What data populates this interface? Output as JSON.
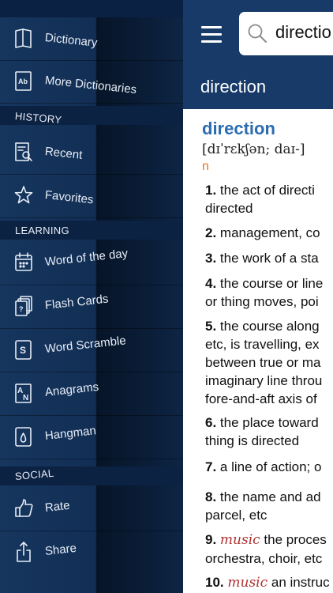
{
  "sidebar": {
    "items": {
      "dictionary": "Dictionary",
      "more_dictionaries": "More Dictionaries",
      "recent": "Recent",
      "favorites": "Favorites",
      "word_of_day": "Word of the day",
      "flash_cards": "Flash Cards",
      "word_scramble": "Word Scramble",
      "anagrams": "Anagrams",
      "hangman": "Hangman",
      "rate": "Rate",
      "share": "Share"
    },
    "sections": {
      "history": "HISTORY",
      "learning": "LEARNING",
      "social": "SOCIAL"
    },
    "icon_glyphs": {
      "more_dictionaries": "Ab",
      "word_scramble": "S",
      "anagrams_a": "A",
      "anagrams_n": "N",
      "flash_cards": "?"
    }
  },
  "header": {
    "search_value": "directio",
    "word_title": "direction"
  },
  "entry": {
    "headword": "direction",
    "pronunciation": "[dɪˈrɛkʃən; daɪ-]",
    "pos": "n",
    "definitions": [
      {
        "num": "1",
        "lines": [
          "the act of directi",
          "directed"
        ]
      },
      {
        "num": "2",
        "lines": [
          "management, co"
        ]
      },
      {
        "num": "3",
        "lines": [
          "the work of a sta"
        ]
      },
      {
        "num": "4",
        "lines": [
          "the course or line",
          "or thing moves, poi"
        ]
      },
      {
        "num": "5",
        "lines": [
          "the course along",
          "etc, is travelling, ex",
          "between true or ma",
          "imaginary line throu",
          "fore-and-aft axis of"
        ]
      },
      {
        "num": "6",
        "lines": [
          "the place toward",
          "thing is directed"
        ]
      },
      {
        "num": "7",
        "lines": [
          "a line of action; o"
        ]
      },
      {
        "num": "8",
        "lines": [
          "the name and ad",
          "parcel, etc"
        ]
      },
      {
        "num": "9",
        "label": "music",
        "lines": [
          "the proces",
          "orchestra, choir, etc"
        ]
      },
      {
        "num": "10",
        "label": "music",
        "lines": [
          "an instruc"
        ]
      }
    ]
  },
  "colors": {
    "sidebar_bg": "#122e54",
    "topbar_bg": "#173a68",
    "headword": "#2b6cb0",
    "pos": "#e87722",
    "label": "#b03030"
  }
}
